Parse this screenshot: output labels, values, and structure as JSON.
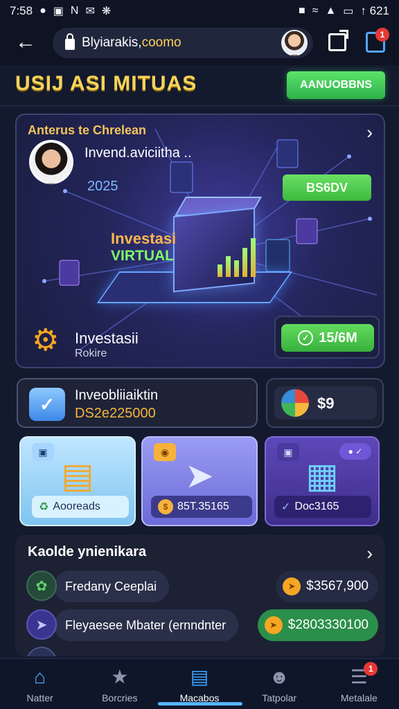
{
  "status_bar": {
    "time": "7:58",
    "right_text": "↑ 621"
  },
  "browser": {
    "url_prefix": "Blyiarakis,",
    "url_domain": "coomo"
  },
  "header": {
    "title": "USIJ ASI MITUAS",
    "button_label": "AANUOBBNS"
  },
  "hero": {
    "caption": "Anterus te Chrelean",
    "subtitle": "Invend.aviciitha ..",
    "year": "2025",
    "green_button": "BS6DV",
    "center_title": "Investasi",
    "center_sub": "VIRTUAL",
    "bottom_title": "Investasii",
    "bottom_sub": "Rokire",
    "stat": "15/6M"
  },
  "summary": {
    "title": "Inveobliiaiktin",
    "value": "DS2e225000",
    "side_value": "$9"
  },
  "tiles": [
    {
      "label": "Aooreads",
      "color": "#7fc4f0"
    },
    {
      "label": "85T.35165",
      "color": "#6c6bd8"
    },
    {
      "label": "Doc3165",
      "color": "#3e2e8b"
    }
  ],
  "list": {
    "title": "Kaolde ynienikara",
    "items": [
      {
        "label": "Fredany Ceeplai",
        "amount": "$3567,900"
      },
      {
        "label": "Fleyaesee Mbater (ernndnter",
        "amount": "$2803330100"
      }
    ]
  },
  "nav": {
    "items": [
      {
        "label": "Natter",
        "icon": "home-icon"
      },
      {
        "label": "Borcries",
        "icon": "star-icon"
      },
      {
        "label": "Macabos",
        "icon": "document-icon"
      },
      {
        "label": "Tatpolar",
        "icon": "person-icon"
      },
      {
        "label": "Metalale",
        "icon": "list-icon"
      }
    ],
    "badge": "1"
  },
  "colors": {
    "background": "#141a2e",
    "accent_green": "#38b03d",
    "accent_gold": "#f7d35a",
    "accent_blue": "#3aa3ff"
  }
}
